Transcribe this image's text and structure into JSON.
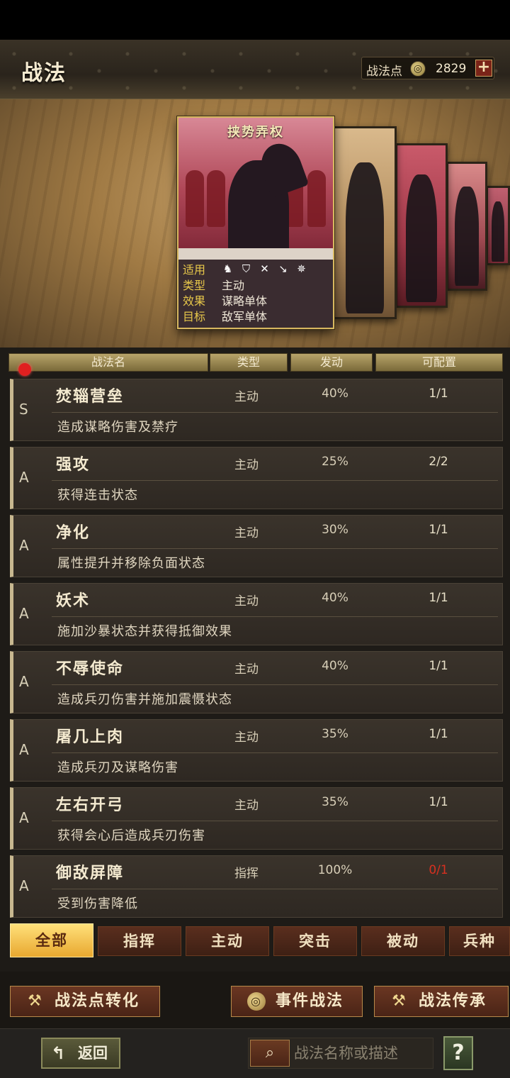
{
  "header": {
    "title": "战法",
    "points_label": "战法点",
    "points_value": "2829",
    "add_label": "+"
  },
  "featured_card": {
    "name": "挟势弄权",
    "labels": {
      "troops": "适用",
      "type": "类型",
      "effect": "效果",
      "target": "目标"
    },
    "troop_icons": [
      "cavalry-icon",
      "shield-icon",
      "bow-icon",
      "spear-icon",
      "chariot-icon"
    ],
    "type": "主动",
    "effect": "谋略单体",
    "target": "敌军单体"
  },
  "table": {
    "headers": {
      "name": "战法名",
      "type": "类型",
      "rate": "发动",
      "quota": "可配置"
    },
    "rows": [
      {
        "grade": "S",
        "name": "焚辎营垒",
        "type": "主动",
        "rate": "40%",
        "quota": "1/1",
        "desc": "造成谋略伤害及禁疗"
      },
      {
        "grade": "A",
        "name": "强攻",
        "type": "主动",
        "rate": "25%",
        "quota": "2/2",
        "desc": "获得连击状态"
      },
      {
        "grade": "A",
        "name": "净化",
        "type": "主动",
        "rate": "30%",
        "quota": "1/1",
        "desc": "属性提升并移除负面状态"
      },
      {
        "grade": "A",
        "name": "妖术",
        "type": "主动",
        "rate": "40%",
        "quota": "1/1",
        "desc": "施加沙暴状态并获得抵御效果"
      },
      {
        "grade": "A",
        "name": "不辱使命",
        "type": "主动",
        "rate": "40%",
        "quota": "1/1",
        "desc": "造成兵刃伤害并施加震慑状态"
      },
      {
        "grade": "A",
        "name": "屠几上肉",
        "type": "主动",
        "rate": "35%",
        "quota": "1/1",
        "desc": "造成兵刃及谋略伤害"
      },
      {
        "grade": "A",
        "name": "左右开弓",
        "type": "主动",
        "rate": "35%",
        "quota": "1/1",
        "desc": "获得会心后造成兵刃伤害"
      },
      {
        "grade": "A",
        "name": "御敌屏障",
        "type": "指挥",
        "rate": "100%",
        "quota": "0/1",
        "desc": "受到伤害降低"
      }
    ]
  },
  "filters": [
    "全部",
    "指挥",
    "主动",
    "突击",
    "被动",
    "兵种"
  ],
  "actions": {
    "convert": "战法点转化",
    "event": "事件战法",
    "inherit": "战法传承"
  },
  "footer": {
    "back": "返回",
    "search_placeholder": "战法名称或描述",
    "help": "?"
  },
  "colors": {
    "accent_gold": "#e8c84a",
    "active_tab": "#f0b840",
    "quota_full": "#d83020"
  }
}
